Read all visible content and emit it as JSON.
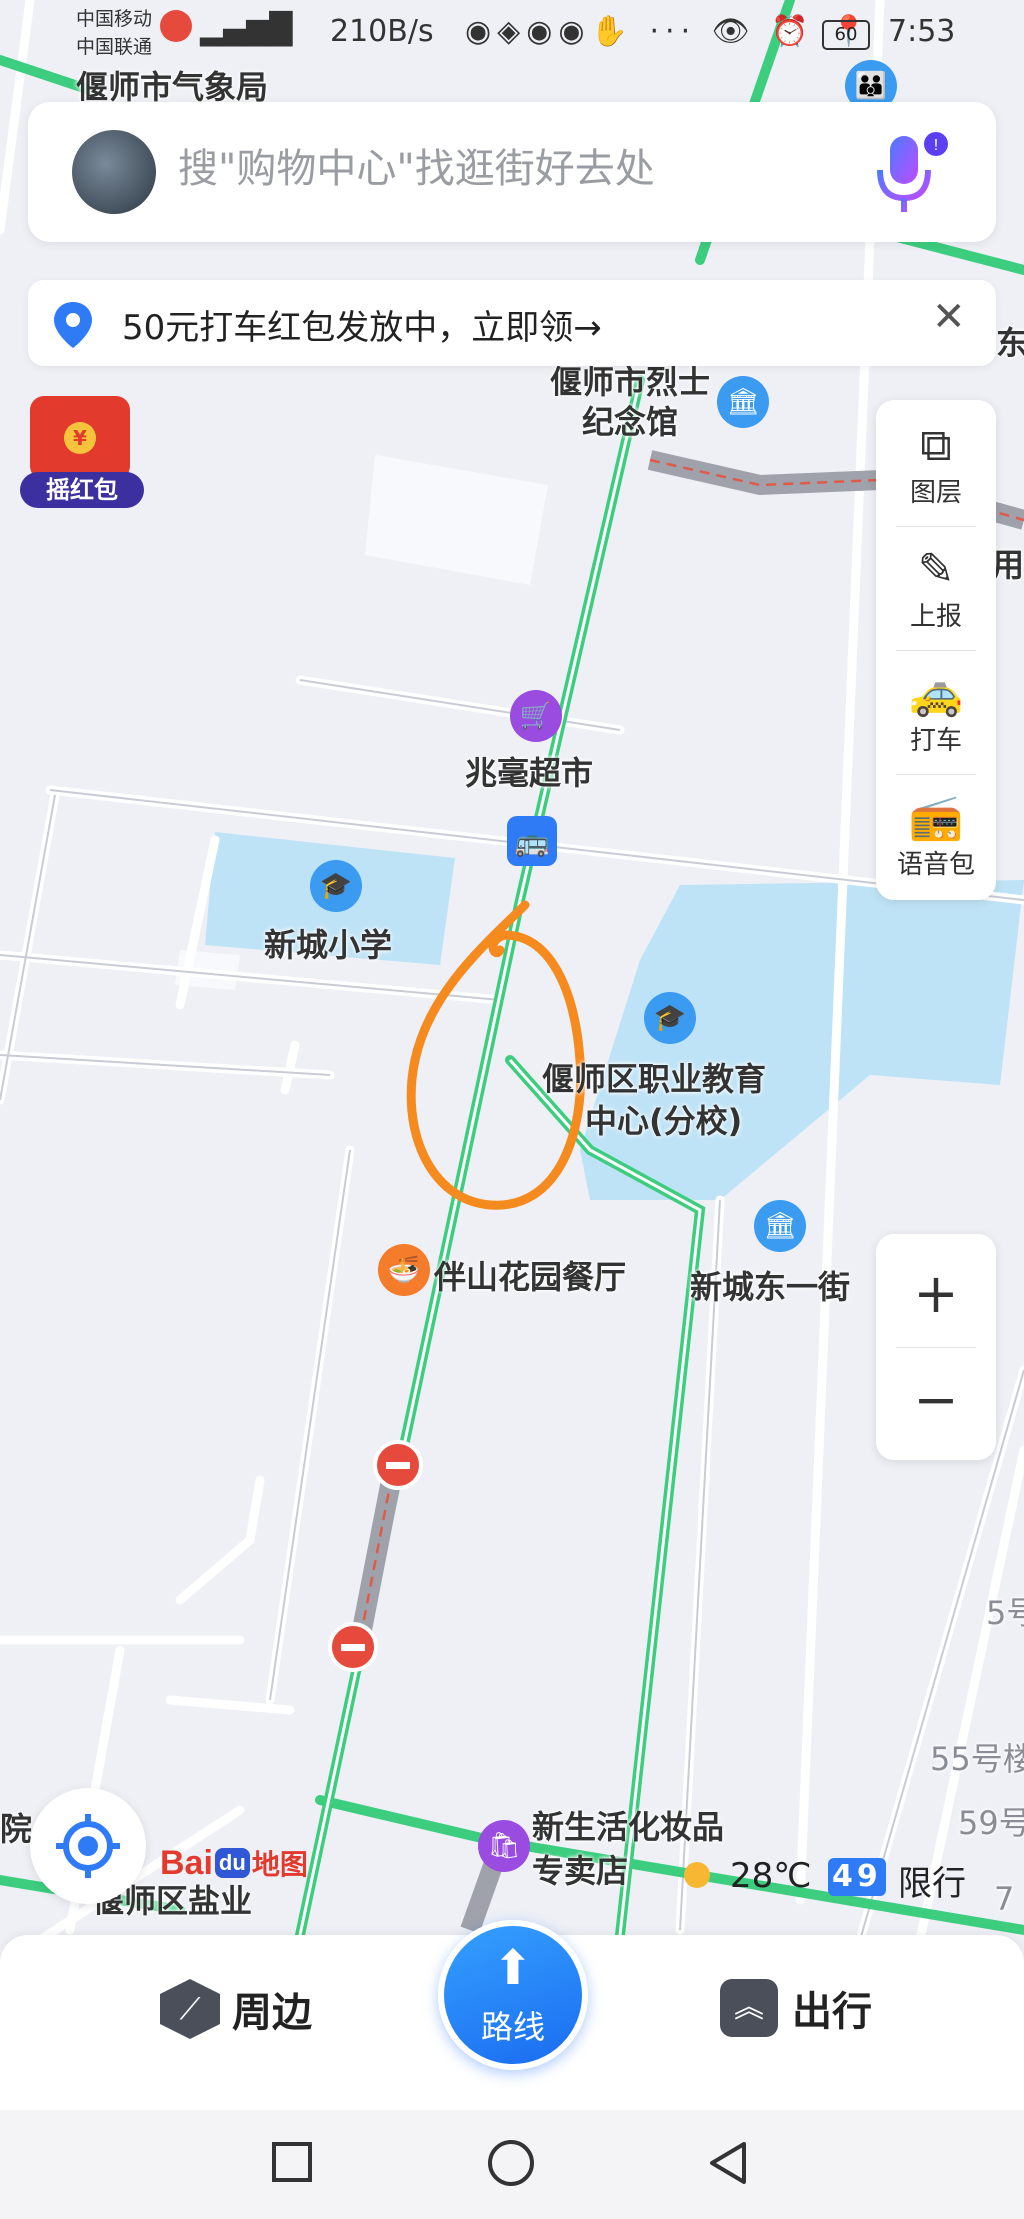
{
  "status_bar": {
    "carrier1": "中国移动",
    "carrier2": "中国联通",
    "net_speed": "210B/s",
    "battery": "60",
    "time": "7:53"
  },
  "search": {
    "placeholder": "搜\"购物中心\"找逛街好去处"
  },
  "promo": {
    "text": "50元打车红包发放中，立即领→"
  },
  "red_packet": {
    "label": "摇红包"
  },
  "side_tools": [
    "图层",
    "上报",
    "打车",
    "语音包"
  ],
  "zoom": {
    "in": "+",
    "out": "−"
  },
  "map_labels": {
    "top_left": "偃师市气象局",
    "martyr": "偃师市烈士\n纪念馆",
    "east_cut": "东",
    "yong_cut": "用",
    "supermarket": "兆毫超市",
    "school": "新城小学",
    "vocational_1": "偃师区职业教育",
    "vocational_2": "中心(分校)",
    "restaurant": "伴山花园餐厅",
    "street": "新城东一街",
    "cosmetics_1": "新生活化妆品",
    "cosmetics_2": "专卖店",
    "salt": "偃师区盐业",
    "hospital_cut": "院",
    "num_5": "5号",
    "num_55": "55号楼",
    "num_59": "59号",
    "num_7": "7"
  },
  "weather": {
    "temp": "28℃",
    "restriction_nums": "49",
    "restriction_label": "限行"
  },
  "baidu_logo": {
    "bai": "Bai",
    "du": "du",
    "map": "地图"
  },
  "bottom_bar": {
    "nearby": "周边",
    "route": "路线",
    "travel": "出行"
  },
  "colors": {
    "accent": "#2f7bf6",
    "road_green": "#3ccd7f",
    "poi_blue": "#3a9bf0",
    "annotation": "#f58b1e"
  }
}
